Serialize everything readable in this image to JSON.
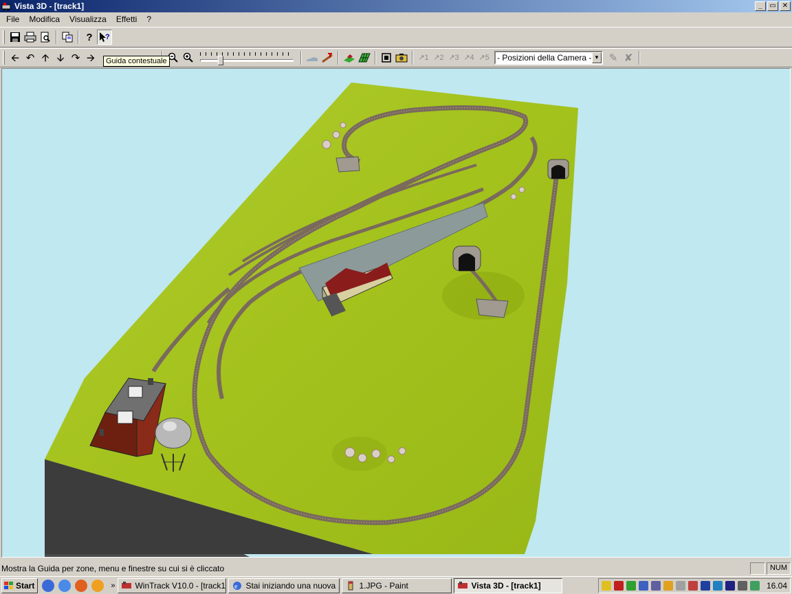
{
  "window": {
    "title": "Vista 3D - [track1]",
    "btn_min": "_",
    "btn_max": "▭",
    "btn_close": "✕"
  },
  "menu": [
    "File",
    "Modifica",
    "Visualizza",
    "Effetti",
    "?"
  ],
  "toolbar2": {
    "camera_select": "- Posizioni della Camera -",
    "tooltip": "Guida contestuale",
    "zoom_slider_percent": 20,
    "camera_labels": [
      "1",
      "2",
      "3",
      "4",
      "5"
    ]
  },
  "statusbar": {
    "text": "Mostra la Guida per zone, menu e finestre su cui si è cliccato",
    "num": "NUM"
  },
  "taskbar": {
    "start": "Start",
    "chevron": "»",
    "tasks": [
      {
        "label": "WinTrack  V10.0 - [track1]",
        "active": false
      },
      {
        "label": "Stai iniziando una nuova ...",
        "active": false
      },
      {
        "label": "1.JPG - Paint",
        "active": false
      },
      {
        "label": "Vista 3D - [track1]",
        "active": true
      }
    ],
    "clock": "16.04"
  },
  "colors": {
    "titlebar_start": "#0a246a",
    "viewport_bg": "#bfe8f0",
    "terrain": "#a8c820",
    "track": "#7a6a5c"
  }
}
